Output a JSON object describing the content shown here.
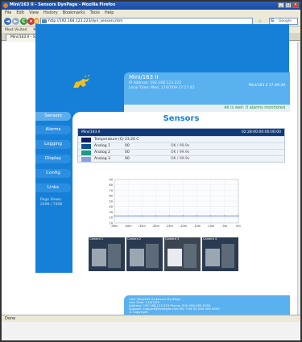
{
  "window": {
    "title": "Mini/163 II - Sensors DynPage - Mozilla Firefox",
    "buttons": {
      "minimize": "_",
      "maximize": "□",
      "close": "×"
    }
  },
  "menu": [
    "File",
    "Edit",
    "View",
    "History",
    "Bookmarks",
    "Tools",
    "Help"
  ],
  "toolbar": {
    "back": "◄",
    "forward": "►",
    "reload": "C",
    "stop": "×",
    "home": "⌂",
    "url": "http://192.168.123.223/dyn_sensors.htm",
    "star": "☆",
    "search_label": "Google"
  },
  "bookmarks": [
    "Most Visited",
    "Mini/163 II 128.123.33"
  ],
  "tab": {
    "label": "Mini/163 II - Sensors DynPage",
    "close": "×"
  },
  "header": {
    "device_name": "Mini/163 II",
    "ip_line": "IP Address: 192.168.123.223",
    "time_line": "Local Time: Wed, 17/07/09 17:17:45",
    "right_info": "Mini/163 II 17:49:39",
    "alarm_status": "All is well: 0 alarms monitored"
  },
  "sidebar": {
    "items": [
      "Sensors",
      "Alarms",
      "Logging",
      "Display",
      "Config",
      "Links"
    ],
    "active": "Sensors",
    "note_line1": "Page Views:",
    "note_line2": "2496   /   7408"
  },
  "main": {
    "title": "Sensors",
    "table": {
      "device": "Mini/163 II",
      "device_id": "02:28:00:00:00:00:00",
      "rows": [
        {
          "name": "Temperature (C)",
          "value": "23.20 C",
          "range": "",
          "color": "#0c1e66"
        },
        {
          "name": "Analog 1",
          "value": "00",
          "range": "OK  / 99.9s",
          "color": "#0e4f8c"
        },
        {
          "name": "Analog 2",
          "value": "00",
          "range": "OK  / 99.9s",
          "color": "#1d9a88"
        },
        {
          "name": "Analog 3",
          "value": "00",
          "range": "OK  / 99.9s",
          "color": "#8a9fe0"
        }
      ]
    },
    "cameras": [
      {
        "label": "Camera 1"
      },
      {
        "label": "Camera 2"
      },
      {
        "label": "Camera 3"
      },
      {
        "label": "Camera 4"
      }
    ]
  },
  "footer": {
    "lines": [
      "Unit: Mini/163 II Sensors DynPage",
      "Unit Time: 17/07/09",
      "Address: 192.168.123.223   Phone: (54) 000-555-5555",
      "Support: support@example.com   Tel: +44 (0) 000 000 0000",
      "© Copyright"
    ]
  },
  "status": {
    "text": "Done"
  },
  "chart_data": {
    "type": "line",
    "title": "",
    "xlabel": "",
    "ylabel": "",
    "x": [
      "-45m",
      "-40m",
      "-35m",
      "-30m",
      "-25m",
      "-20m",
      "-15m",
      "-10m",
      "-5m",
      "0m"
    ],
    "ylim": [
      10,
      90
    ],
    "yticks": [
      10,
      20,
      30,
      40,
      50,
      60,
      70,
      80,
      90
    ],
    "grid": true,
    "series": [
      {
        "values": [
          23,
          23,
          23,
          23,
          23,
          23,
          23,
          23,
          23,
          23
        ],
        "color": "#4a6fb0"
      }
    ]
  }
}
